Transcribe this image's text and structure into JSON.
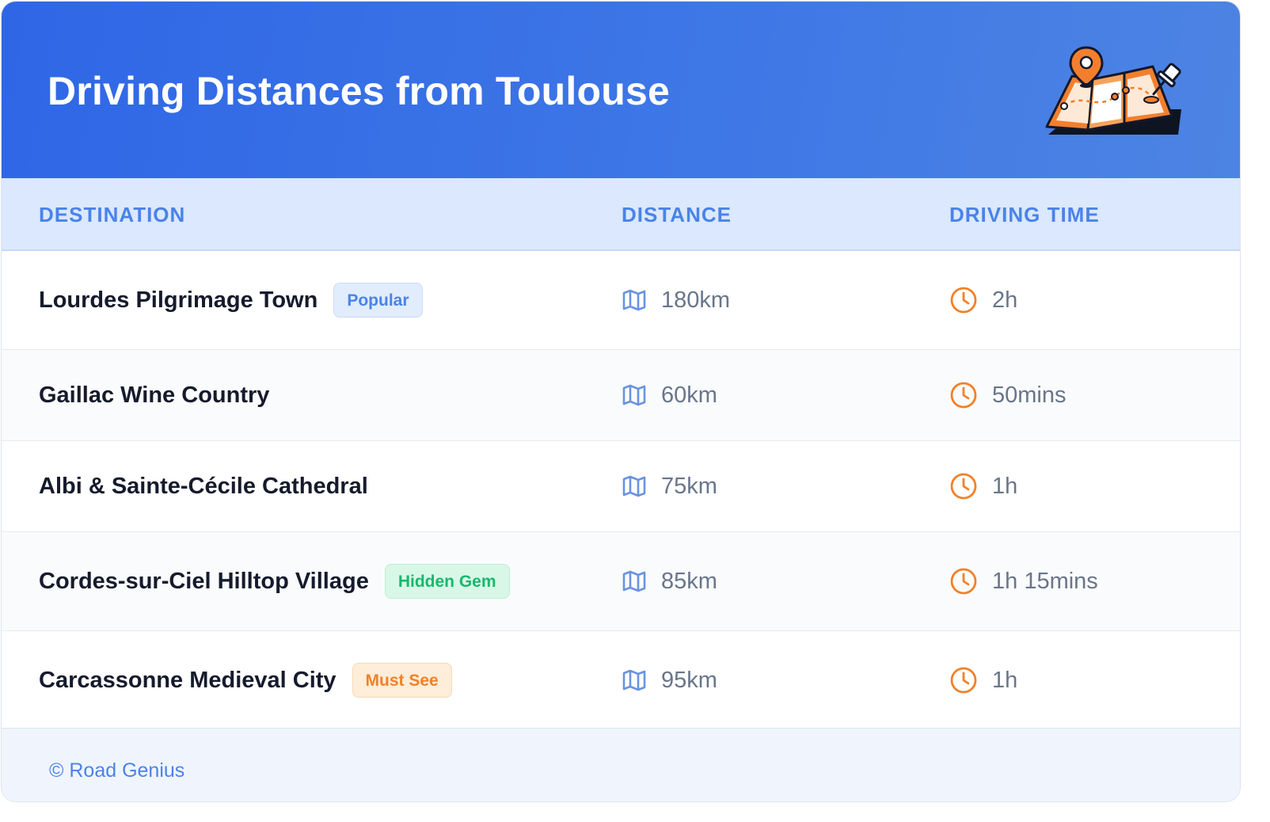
{
  "header": {
    "title": "Driving Distances from Toulouse",
    "illustration_icon": "folded-map-with-pins-icon"
  },
  "table": {
    "columns": [
      "DESTINATION",
      "DISTANCE",
      "DRIVING TIME"
    ],
    "rows": [
      {
        "destination": "Lourdes Pilgrimage Town",
        "badge": "Popular",
        "badge_color": "#4a83e8",
        "distance": "180km",
        "time": "2h"
      },
      {
        "destination": "Gaillac Wine Country",
        "badge": "",
        "badge_color": "",
        "distance": "60km",
        "time": "50mins"
      },
      {
        "destination": "Albi & Sainte-Cécile Cathedral",
        "badge": "",
        "badge_color": "",
        "distance": "75km",
        "time": "1h"
      },
      {
        "destination": "Cordes-sur-Ciel Hilltop Village",
        "badge": "Hidden Gem",
        "badge_color": "#18b86e",
        "distance": "85km",
        "time": "1h 15mins"
      },
      {
        "destination": "Carcassonne Medieval City",
        "badge": "Must See",
        "badge_color": "#f0812a",
        "distance": "95km",
        "time": "1h"
      }
    ]
  },
  "icons": {
    "distance": "map-icon",
    "time": "clock-icon"
  },
  "footer": {
    "copyright": "© Road Genius"
  },
  "colors": {
    "header_gradient_start": "#2f66e6",
    "header_gradient_end": "#4d84e3",
    "accent_blue": "#4a83e8",
    "accent_orange": "#f0812a",
    "accent_green": "#18b86e"
  }
}
